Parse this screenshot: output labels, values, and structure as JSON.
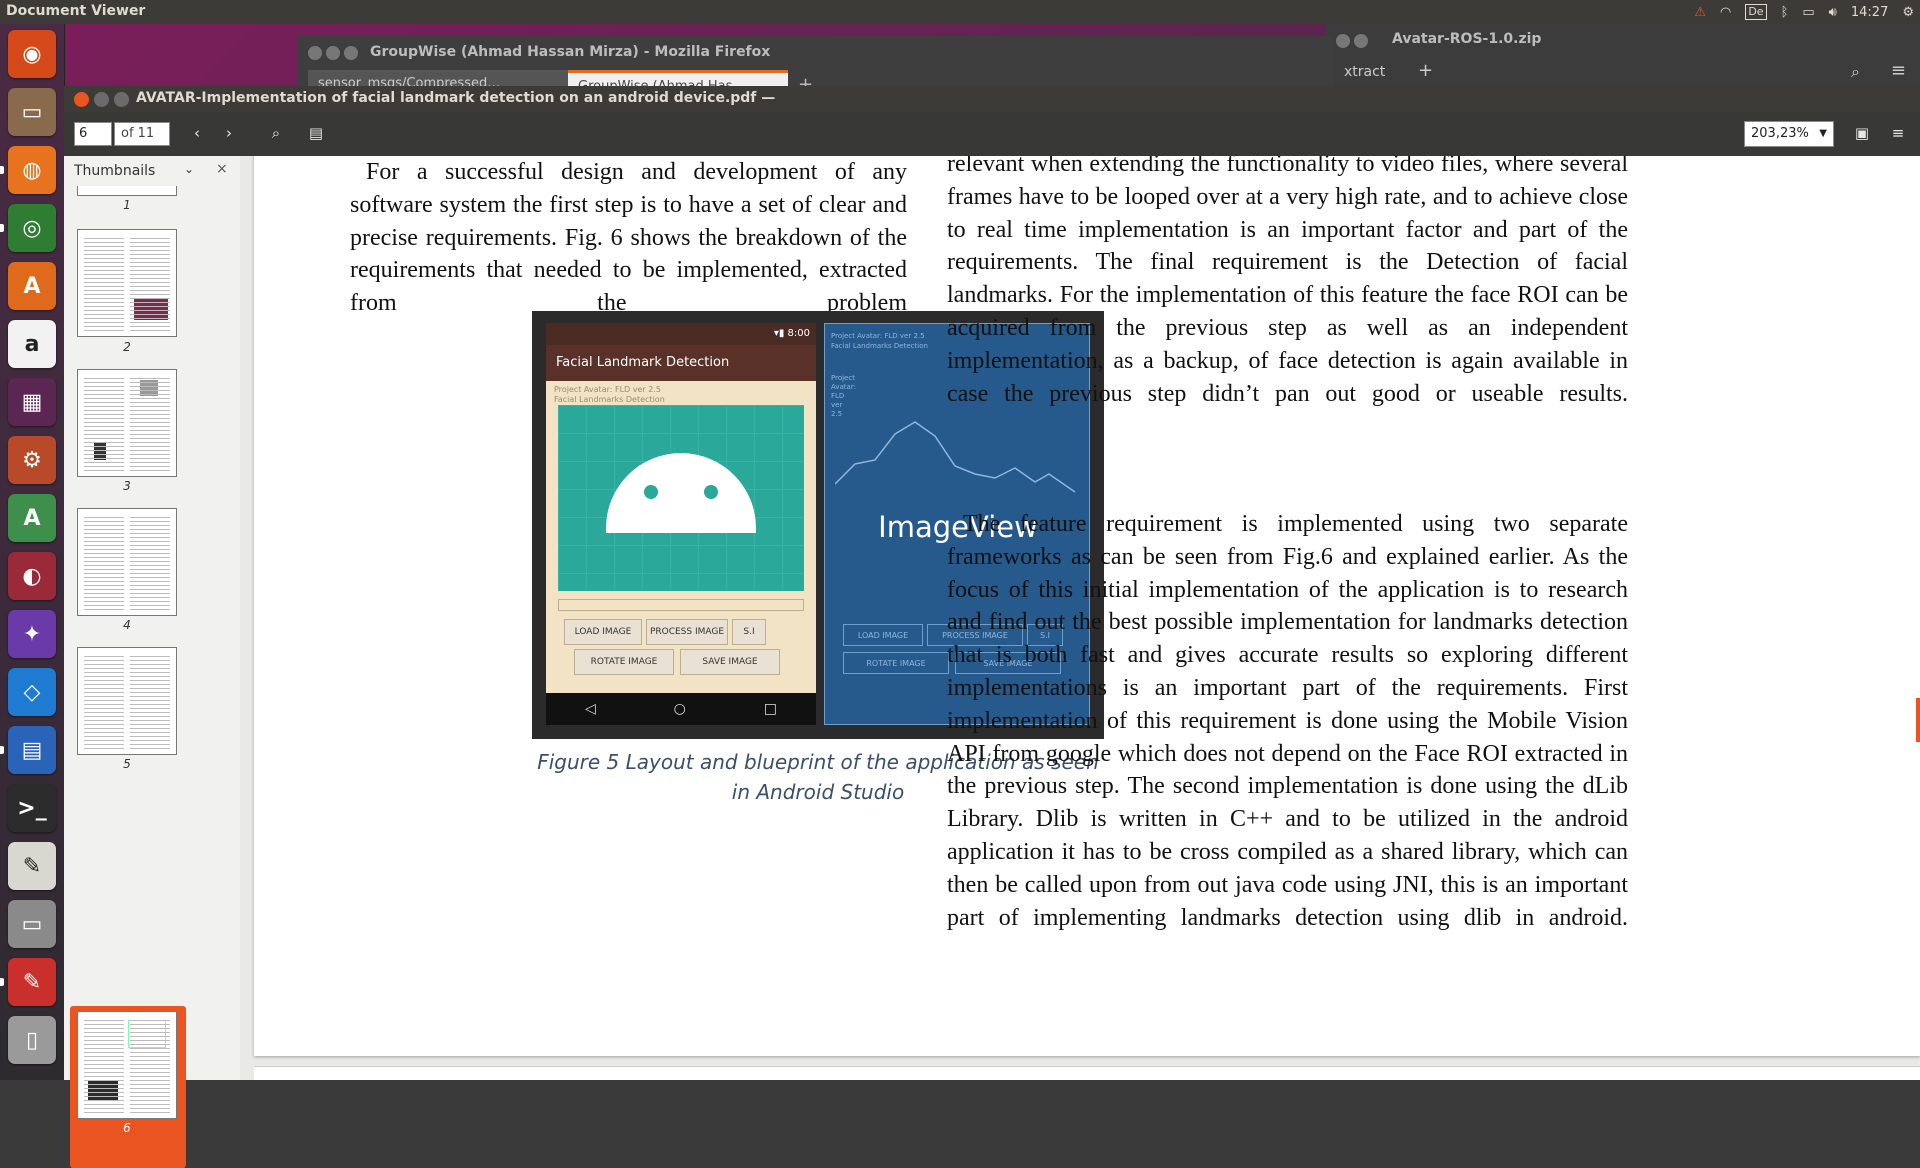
{
  "top_panel": {
    "app_name": "Document Viewer",
    "keyboard_layout": "De",
    "time": "14:27"
  },
  "launcher": {
    "items": [
      {
        "name": "ubuntu-dash-icon",
        "color": "#d64a1a",
        "glyph": "◉"
      },
      {
        "name": "files-icon",
        "color": "#8a6a4c",
        "glyph": "▭"
      },
      {
        "name": "firefox-icon",
        "color": "#e7731f",
        "glyph": "◍"
      },
      {
        "name": "chrome-icon",
        "color": "#2e7d32",
        "glyph": "◎"
      },
      {
        "name": "software-center-icon",
        "color": "#e06a1b",
        "glyph": "A"
      },
      {
        "name": "amazon-icon",
        "color": "#f2f2f2",
        "glyph": "a"
      },
      {
        "name": "workspace-switcher-icon",
        "color": "#5b2752",
        "glyph": "▦"
      },
      {
        "name": "system-settings-icon",
        "color": "#b84a2a",
        "glyph": "⚙"
      },
      {
        "name": "android-studio-icon",
        "color": "#3f8f4c",
        "glyph": "A"
      },
      {
        "name": "disk-icon",
        "color": "#9a2a3a",
        "glyph": "◐"
      },
      {
        "name": "gtkwave-icon",
        "color": "#6a3aa8",
        "glyph": "✦"
      },
      {
        "name": "vscode-icon",
        "color": "#1f7ad1",
        "glyph": "◇"
      },
      {
        "name": "libreoffice-writer-icon",
        "color": "#2a64b8",
        "glyph": "▤"
      },
      {
        "name": "terminal-icon",
        "color": "#2c2c2c",
        "glyph": ">_"
      },
      {
        "name": "text-editor-icon",
        "color": "#d8d8d0",
        "glyph": "✎"
      },
      {
        "name": "scanner-icon",
        "color": "#8a8a8a",
        "glyph": "▭"
      },
      {
        "name": "document-viewer-icon",
        "color": "#c9302c",
        "glyph": "✎"
      },
      {
        "name": "trash-icon",
        "color": "#9a9a9a",
        "glyph": "▯"
      }
    ]
  },
  "firefox_window": {
    "title": "GroupWise (Ahmad Hassan Mirza) - Mozilla Firefox",
    "tab1": "sensor_msgs/Compressed…",
    "tab2": "GroupWise (Ahmad Has…"
  },
  "archive_window": {
    "title": "Avatar-ROS-1.0.zip",
    "tab": "xtract"
  },
  "doc_window": {
    "title": "AVATAR-Implementation of facial landmark detection on an android device.pdf —",
    "current_page": "6",
    "page_count": "of 11",
    "zoom": "203,23%"
  },
  "sidebar": {
    "title": "Thumbnails",
    "thumbnails": [
      "1",
      "2",
      "3",
      "4",
      "5",
      "6"
    ]
  },
  "document": {
    "left_column": "For a successful design and development of any software system the first step is to have a set of clear and precise requirements. Fig. 6 shows the breakdown of the requirements that needed to be implemented, extracted from the problem",
    "right_column_p1": "relevant when extending the functionality to video files, where several frames have to be looped over at a very high rate, and to achieve close to real time implementation is an important factor and part of the requirements. The final requirement is the Detection of facial landmarks. For the implementation of this feature the face ROI can be acquired from the previous step as well as an independent implementation, as a backup, of face detection is again available in case the previous step didn’t pan out good or useable results.",
    "right_column_p2": "The feature requirement is implemented using two separate frameworks as can be seen from Fig.6 and explained earlier. As the focus of this initial implementation of the application is to research and find out the best possible implementation for landmarks detection that is both fast and gives accurate results so exploring different implementations is an important part of the requirements. First implementation of this requirement is done using the Mobile Vision API from google which does not depend on the Face ROI extracted in the previous step. The second implementation is done using the dLib Library. Dlib is written in C++ and to be utilized in the android application it has to be cross compiled as a shared library, which can then be called upon from out java code using JNI, this is an important part of implementing landmarks detection using dlib in android.",
    "figure": {
      "status_time": "8:00",
      "app_bar": "Facial Landmark Detection",
      "project_line": "Project Avatar: FLD ver 2.5",
      "subtitle_line": "Facial Landmarks Detection",
      "buttons": [
        "LOAD IMAGE",
        "PROCESS IMAGE",
        "S.I",
        "ROTATE IMAGE",
        "SAVE IMAGE"
      ],
      "blueprint_label": "ImageView",
      "caption": "Figure 5 Layout and blueprint of the application as seen in Android Studio"
    }
  },
  "colors": {
    "accent": "#e95420",
    "blueprint": "#265a8c",
    "android_green": "#2aa89a"
  }
}
